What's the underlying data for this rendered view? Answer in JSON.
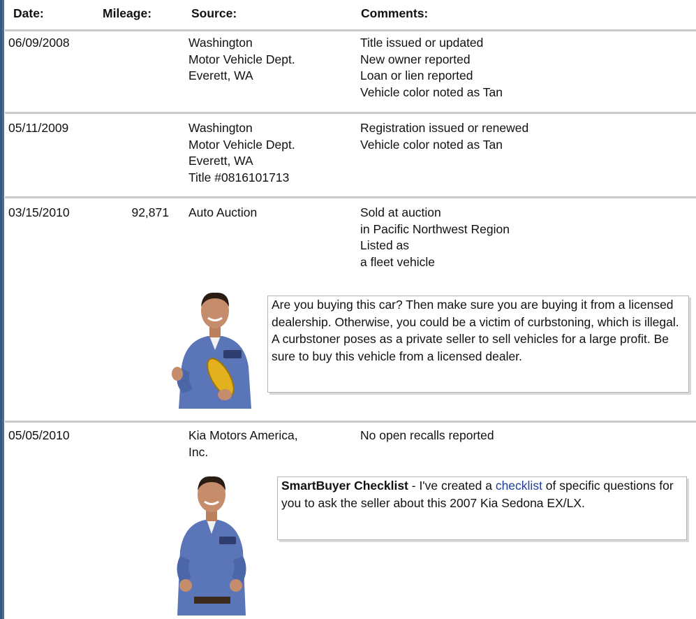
{
  "headers": {
    "date": "Date:",
    "mileage": "Mileage:",
    "source": "Source:",
    "comments": "Comments:"
  },
  "records": [
    {
      "date": "06/09/2008",
      "mileage": "",
      "source": [
        "Washington",
        "Motor Vehicle Dept.",
        "Everett, WA"
      ],
      "comments": [
        "Title issued or updated",
        "New owner reported",
        "Loan or lien reported",
        "Vehicle color noted as Tan"
      ]
    },
    {
      "date": "05/11/2009",
      "mileage": "",
      "source": [
        "Washington",
        "Motor Vehicle Dept.",
        "Everett, WA",
        "Title #0816101713"
      ],
      "comments": [
        "Registration issued or renewed",
        "Vehicle color noted as Tan"
      ]
    },
    {
      "date": "03/15/2010",
      "mileage": "92,871",
      "source": [
        "Auto Auction"
      ],
      "comments": [
        "Sold at auction",
        "in Pacific Northwest Region",
        "Listed as",
        "a fleet vehicle"
      ]
    },
    {
      "date": "05/05/2010",
      "mileage": "",
      "source": [
        "Kia Motors America,",
        "Inc."
      ],
      "comments": [
        "No open recalls reported"
      ]
    }
  ],
  "callout_curbstoning": {
    "text": "Are you buying this car? Then make sure you are buying it from a licensed dealership. Otherwise, you could be a victim of curbstoning, which is illegal. A curbstoner poses as a private seller to sell vehicles for a large profit. Be sure to buy this vehicle from a licensed dealer."
  },
  "callout_checklist": {
    "title": "SmartBuyer Checklist",
    "text_before_link": " - I've created a ",
    "link_text": "checklist",
    "text_after_link": " of specific questions for you to ask the seller about this 2007 Kia Sedona EX/LX."
  },
  "colors": {
    "accent_border": "#4a6d96",
    "row_divider": "#c9c9c9",
    "link": "#1f3f9a",
    "shirt": "#5b76b8"
  }
}
